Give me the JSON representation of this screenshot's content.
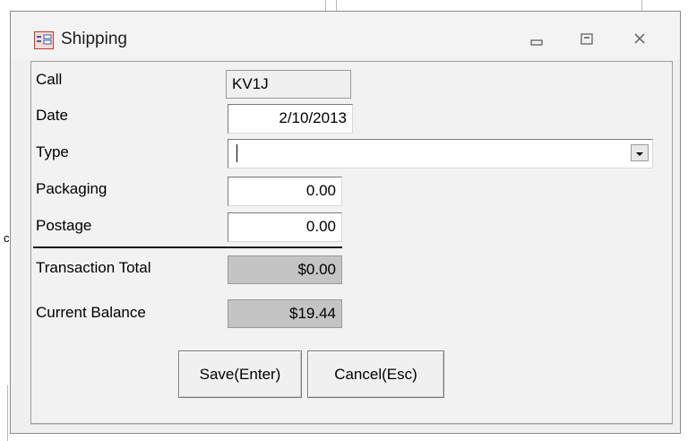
{
  "window": {
    "title": "Shipping",
    "controls": [
      "minimize-icon",
      "maximize-icon",
      "close-icon"
    ]
  },
  "form": {
    "call": {
      "label": "Call",
      "value": "KV1J"
    },
    "date": {
      "label": "Date",
      "value": "2/10/2013"
    },
    "type": {
      "label": "Type",
      "value": ""
    },
    "packaging": {
      "label": "Packaging",
      "value": "0.00"
    },
    "postage": {
      "label": "Postage",
      "value": "0.00"
    },
    "transaction_total": {
      "label": "Transaction Total",
      "value": "$0.00"
    },
    "current_balance": {
      "label": "Current Balance",
      "value": "$19.44"
    }
  },
  "buttons": {
    "save": "Save(Enter)",
    "cancel": "Cancel(Esc)"
  },
  "background": {
    "stub_text": "c"
  },
  "colors": {
    "window_bg": "#f0f0f0",
    "readonly_gray": "#c4c4c4",
    "icon_accent": "#c0392b"
  }
}
